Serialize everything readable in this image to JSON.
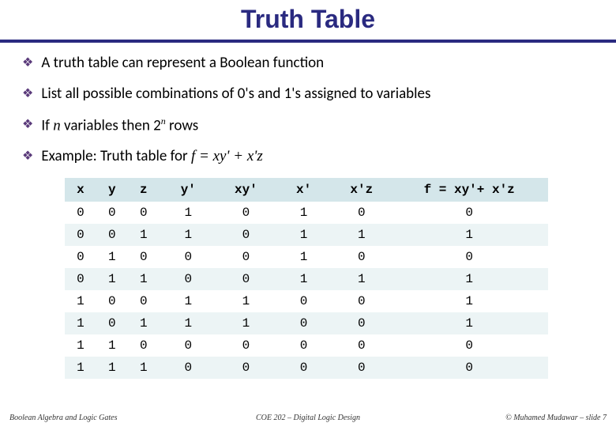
{
  "title": "Truth Table",
  "bullets": {
    "b1": "A truth table can represent a Boolean function",
    "b2": "List all possible combinations of 0's and 1's assigned to variables",
    "b3_pre": "If ",
    "b3_n": "n",
    "b3_mid": " variables then 2",
    "b3_sup": "n",
    "b3_post": " rows",
    "b4_pre": "Example: Truth table for ",
    "b4_eq": "f = xy' + x'z"
  },
  "chart_data": {
    "type": "table",
    "title": "Truth table for f = xy' + x'z",
    "columns": [
      "x",
      "y",
      "z",
      "y'",
      "xy'",
      "x'",
      "x'z",
      "f = xy'+ x'z"
    ],
    "rows": [
      [
        "0",
        "0",
        "0",
        "1",
        "0",
        "1",
        "0",
        "0"
      ],
      [
        "0",
        "0",
        "1",
        "1",
        "0",
        "1",
        "1",
        "1"
      ],
      [
        "0",
        "1",
        "0",
        "0",
        "0",
        "1",
        "0",
        "0"
      ],
      [
        "0",
        "1",
        "1",
        "0",
        "0",
        "1",
        "1",
        "1"
      ],
      [
        "1",
        "0",
        "0",
        "1",
        "1",
        "0",
        "0",
        "1"
      ],
      [
        "1",
        "0",
        "1",
        "1",
        "1",
        "0",
        "0",
        "1"
      ],
      [
        "1",
        "1",
        "0",
        "0",
        "0",
        "0",
        "0",
        "0"
      ],
      [
        "1",
        "1",
        "1",
        "0",
        "0",
        "0",
        "0",
        "0"
      ]
    ]
  },
  "footer": {
    "left": "Boolean Algebra and Logic Gates",
    "mid": "COE 202 – Digital Logic Design",
    "right": "© Muhamed Mudawar – slide 7"
  }
}
